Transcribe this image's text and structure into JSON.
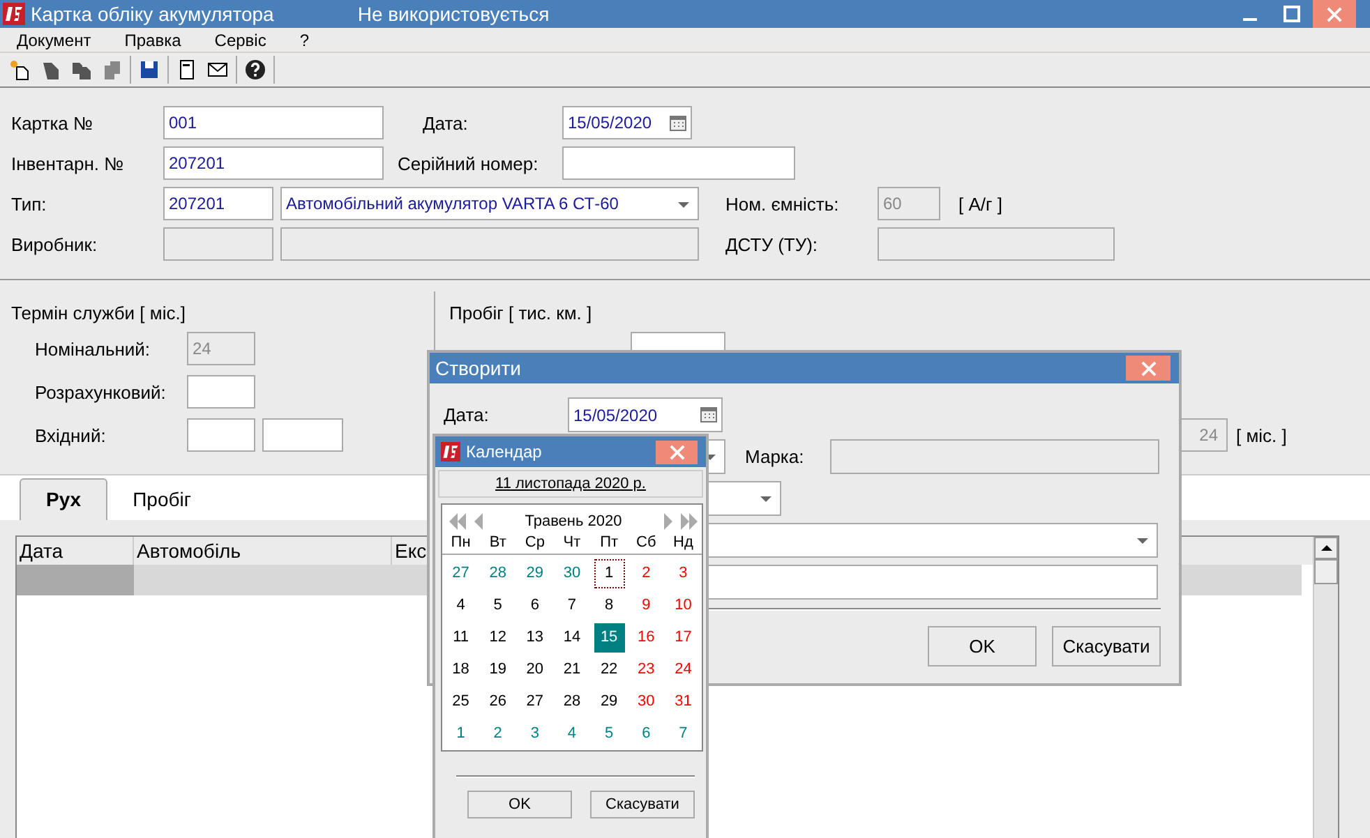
{
  "window": {
    "title": "Картка обліку акумулятора",
    "status": "Не використовується"
  },
  "menu": [
    "Документ",
    "Правка",
    "Сервіс",
    "?"
  ],
  "card": {
    "number_label": "Картка №",
    "number": "001",
    "date_label": "Дата:",
    "date": "15/05/2020",
    "inventory_label": "Інвентарн. №",
    "inventory": "207201",
    "serial_label": "Серійний номер:",
    "type_label": "Тип:",
    "type_code": "207201",
    "type_name": "Автомобільний акумулятор VARTA 6 СТ-60",
    "capacity_label": "Ном. ємність:",
    "capacity": "60",
    "capacity_unit": "[ А/г ]",
    "maker_label": "Виробник:",
    "standard_label": "ДСТУ (ТУ):"
  },
  "service_life": {
    "title": "Термін служби [ міс.]",
    "nominal_label": "Номінальний:",
    "nominal": "24",
    "calculated_label": "Розрахунковий:",
    "input_label": "Вхідний:"
  },
  "mileage": {
    "title": "Пробіг [ тис. км. ]",
    "period": "24",
    "period_unit": "[ міс. ]"
  },
  "tabs": [
    {
      "label": "Рух",
      "selected": true
    },
    {
      "label": "Пробіг",
      "selected": false
    }
  ],
  "table": {
    "columns": [
      "Дата",
      "Автомобіль",
      "Екс"
    ]
  },
  "create_dialog": {
    "title": "Створити",
    "date_label": "Дата:",
    "date": "15/05/2020",
    "brand_label": "Марка:",
    "buttons": [
      "OK",
      "Скасувати"
    ]
  },
  "calendar": {
    "title": "Календар",
    "today": "11 листопада 2020 р.",
    "month": "Травень 2020",
    "weekdays": [
      "Пн",
      "Вт",
      "Ср",
      "Чт",
      "Пт",
      "Сб",
      "Нд"
    ],
    "days": [
      {
        "day": "27",
        "kind": "other",
        "selected": false,
        "focused": false
      },
      {
        "day": "28",
        "kind": "other",
        "selected": false,
        "focused": false
      },
      {
        "day": "29",
        "kind": "other",
        "selected": false,
        "focused": false
      },
      {
        "day": "30",
        "kind": "other",
        "selected": false,
        "focused": false
      },
      {
        "day": "1",
        "kind": "normal",
        "selected": false,
        "focused": true
      },
      {
        "day": "2",
        "kind": "weekend",
        "selected": false,
        "focused": false
      },
      {
        "day": "3",
        "kind": "weekend",
        "selected": false,
        "focused": false
      },
      {
        "day": "4",
        "kind": "normal",
        "selected": false,
        "focused": false
      },
      {
        "day": "5",
        "kind": "normal",
        "selected": false,
        "focused": false
      },
      {
        "day": "6",
        "kind": "normal",
        "selected": false,
        "focused": false
      },
      {
        "day": "7",
        "kind": "normal",
        "selected": false,
        "focused": false
      },
      {
        "day": "8",
        "kind": "normal",
        "selected": false,
        "focused": false
      },
      {
        "day": "9",
        "kind": "weekend",
        "selected": false,
        "focused": false
      },
      {
        "day": "10",
        "kind": "weekend",
        "selected": false,
        "focused": false
      },
      {
        "day": "11",
        "kind": "normal",
        "selected": false,
        "focused": false
      },
      {
        "day": "12",
        "kind": "normal",
        "selected": false,
        "focused": false
      },
      {
        "day": "13",
        "kind": "normal",
        "selected": false,
        "focused": false
      },
      {
        "day": "14",
        "kind": "normal",
        "selected": false,
        "focused": false
      },
      {
        "day": "15",
        "kind": "normal",
        "selected": true,
        "focused": false
      },
      {
        "day": "16",
        "kind": "weekend",
        "selected": false,
        "focused": false
      },
      {
        "day": "17",
        "kind": "weekend",
        "selected": false,
        "focused": false
      },
      {
        "day": "18",
        "kind": "normal",
        "selected": false,
        "focused": false
      },
      {
        "day": "19",
        "kind": "normal",
        "selected": false,
        "focused": false
      },
      {
        "day": "20",
        "kind": "normal",
        "selected": false,
        "focused": false
      },
      {
        "day": "21",
        "kind": "normal",
        "selected": false,
        "focused": false
      },
      {
        "day": "22",
        "kind": "normal",
        "selected": false,
        "focused": false
      },
      {
        "day": "23",
        "kind": "weekend",
        "selected": false,
        "focused": false
      },
      {
        "day": "24",
        "kind": "weekend",
        "selected": false,
        "focused": false
      },
      {
        "day": "25",
        "kind": "normal",
        "selected": false,
        "focused": false
      },
      {
        "day": "26",
        "kind": "normal",
        "selected": false,
        "focused": false
      },
      {
        "day": "27",
        "kind": "normal",
        "selected": false,
        "focused": false
      },
      {
        "day": "28",
        "kind": "normal",
        "selected": false,
        "focused": false
      },
      {
        "day": "29",
        "kind": "normal",
        "selected": false,
        "focused": false
      },
      {
        "day": "30",
        "kind": "weekend",
        "selected": false,
        "focused": false
      },
      {
        "day": "31",
        "kind": "weekend",
        "selected": false,
        "focused": false
      },
      {
        "day": "1",
        "kind": "other",
        "selected": false,
        "focused": false
      },
      {
        "day": "2",
        "kind": "other",
        "selected": false,
        "focused": false
      },
      {
        "day": "3",
        "kind": "other",
        "selected": false,
        "focused": false
      },
      {
        "day": "4",
        "kind": "other",
        "selected": false,
        "focused": false
      },
      {
        "day": "5",
        "kind": "other",
        "selected": false,
        "focused": false
      },
      {
        "day": "6",
        "kind": "other",
        "selected": false,
        "focused": false
      },
      {
        "day": "7",
        "kind": "other",
        "selected": false,
        "focused": false
      }
    ],
    "buttons": [
      "OK",
      "Скасувати"
    ]
  }
}
